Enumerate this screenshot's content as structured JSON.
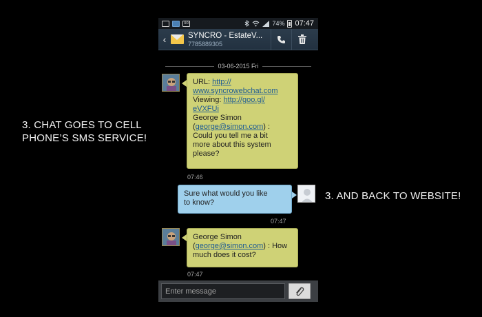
{
  "captions": {
    "left": "3. CHAT GOES TO CELL PHONE’S SMS SERVICE!",
    "right": "3. AND BACK TO WEBSITE!"
  },
  "statusbar": {
    "left_icons": [
      "picture-icon",
      "app-icon",
      "voicemail-icon"
    ],
    "battery_percent": "74%",
    "clock": "07:47"
  },
  "actionbar": {
    "contact_name": "SYNCRO - EstateV...",
    "contact_number": "7785889305",
    "call_icon": "phone-icon",
    "delete_icon": "trash-icon"
  },
  "conversation": {
    "date": "03-06-2015 Fri",
    "messages": [
      {
        "direction": "incoming",
        "lines": [
          "URL: ",
          "http://",
          "www.syncrowebchat.com",
          "Viewing: ",
          "http://goo.gl/",
          "eVXFUi",
          "George Simon",
          "(",
          "george@simon.com",
          ") :",
          "Could you tell me a bit",
          "more about this system",
          "please?"
        ],
        "time": "07:46"
      },
      {
        "direction": "outgoing",
        "lines": [
          "Sure what would you like",
          "to know?"
        ],
        "time": "07:47"
      },
      {
        "direction": "incoming",
        "lines": [
          "George Simon",
          "(",
          "george@simon.com",
          ") : How",
          "much does it cost?"
        ],
        "time": "07:47"
      }
    ]
  },
  "composer": {
    "placeholder": "Enter message",
    "attach_icon": "paperclip-icon"
  },
  "colors": {
    "incoming_bubble": "#cfd276",
    "outgoing_bubble": "#9fd0ec",
    "link": "#1c5a94",
    "actionbar": "#2c3c4c",
    "envelope": "#f4c64a"
  }
}
